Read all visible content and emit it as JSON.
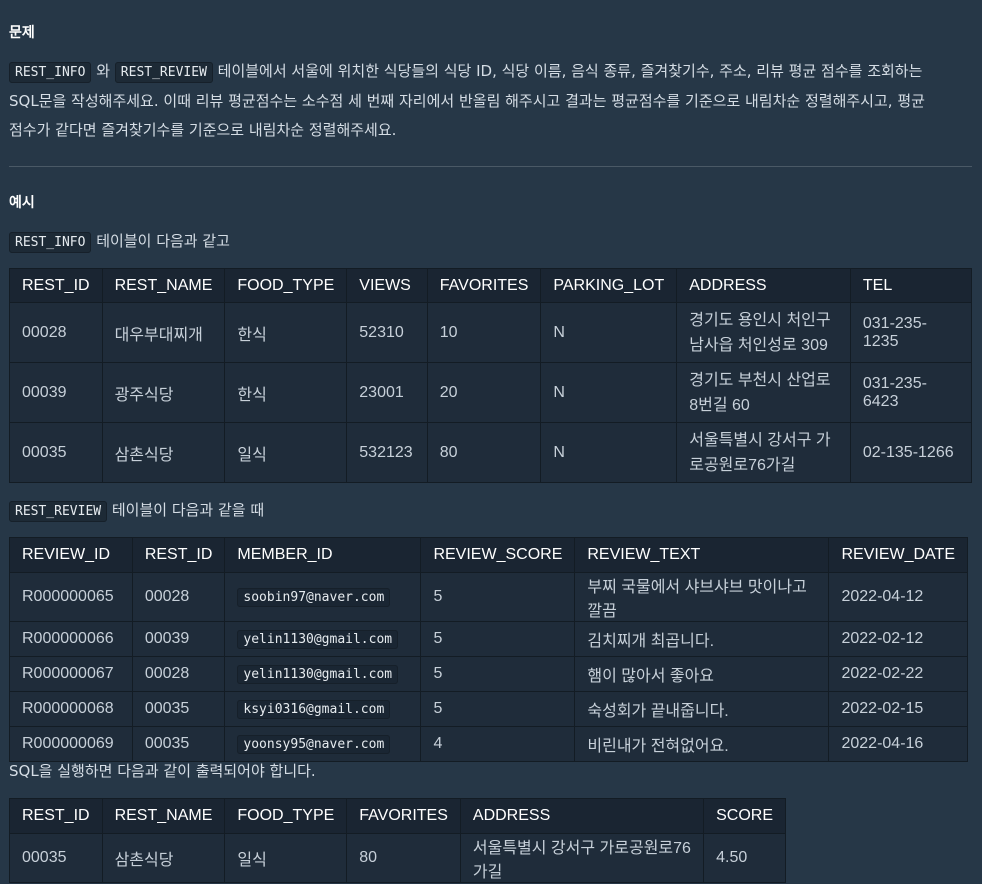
{
  "problem_heading": "문제",
  "problem_text": {
    "code1": "REST_INFO",
    "connector": " 와 ",
    "code2": "REST_REVIEW",
    "line1_rest": " 테이블에서 서울에 위치한 식당들의 식당 ID, 식당 이름, 음식 종류, 즐겨찾기수, 주소, 리뷰 평균 점수를 조회하는",
    "line2": "SQL문을 작성해주세요. 이때 리뷰 평균점수는 소수점 세 번째 자리에서 반올림 해주시고 결과는 평균점수를 기준으로 내림차순 정렬해주시고, 평균",
    "line3": "점수가 같다면 즐겨찾기수를 기준으로 내림차순 정렬해주세요."
  },
  "example_heading": "예시",
  "rest_info_caption": {
    "code": "REST_INFO",
    "text": " 테이블이 다음과 같고"
  },
  "rest_info_table": {
    "headers": [
      "REST_ID",
      "REST_NAME",
      "FOOD_TYPE",
      "VIEWS",
      "FAVORITES",
      "PARKING_LOT",
      "ADDRESS",
      "TEL"
    ],
    "rows": [
      [
        "00028",
        "대우부대찌개",
        "한식",
        "52310",
        "10",
        "N",
        "경기도 용인시 처인구 남사읍 처인성로 309",
        "031-235-1235"
      ],
      [
        "00039",
        "광주식당",
        "한식",
        "23001",
        "20",
        "N",
        "경기도 부천시 산업로8번길 60",
        "031-235-6423"
      ],
      [
        "00035",
        "삼촌식당",
        "일식",
        "532123",
        "80",
        "N",
        "서울특별시 강서구 가로공원로76가길",
        "02-135-1266"
      ]
    ]
  },
  "rest_review_caption": {
    "code": "REST_REVIEW",
    "text": " 테이블이 다음과 같을 때"
  },
  "rest_review_table": {
    "headers": [
      "REVIEW_ID",
      "REST_ID",
      "MEMBER_ID",
      "REVIEW_SCORE",
      "REVIEW_TEXT",
      "REVIEW_DATE"
    ],
    "rows": [
      [
        "R000000065",
        "00028",
        "soobin97@naver.com",
        "5",
        "부찌 국물에서 샤브샤브 맛이나고 깔끔",
        "2022-04-12"
      ],
      [
        "R000000066",
        "00039",
        "yelin1130@gmail.com",
        "5",
        "김치찌개 최곱니다.",
        "2022-02-12"
      ],
      [
        "R000000067",
        "00028",
        "yelin1130@gmail.com",
        "5",
        "햄이 많아서 좋아요",
        "2022-02-22"
      ],
      [
        "R000000068",
        "00035",
        "ksyi0316@gmail.com",
        "5",
        "숙성회가 끝내줍니다.",
        "2022-02-15"
      ],
      [
        "R000000069",
        "00035",
        "yoonsy95@naver.com",
        "4",
        "비린내가 전혀없어요.",
        "2022-04-16"
      ]
    ]
  },
  "result_caption": "SQL을 실행하면 다음과 같이 출력되어야 합니다.",
  "result_table": {
    "headers": [
      "REST_ID",
      "REST_NAME",
      "FOOD_TYPE",
      "FAVORITES",
      "ADDRESS",
      "SCORE"
    ],
    "rows": [
      [
        "00035",
        "삼촌식당",
        "일식",
        "80",
        "서울특별시 강서구 가로공원로76가길",
        "4.50"
      ]
    ]
  }
}
